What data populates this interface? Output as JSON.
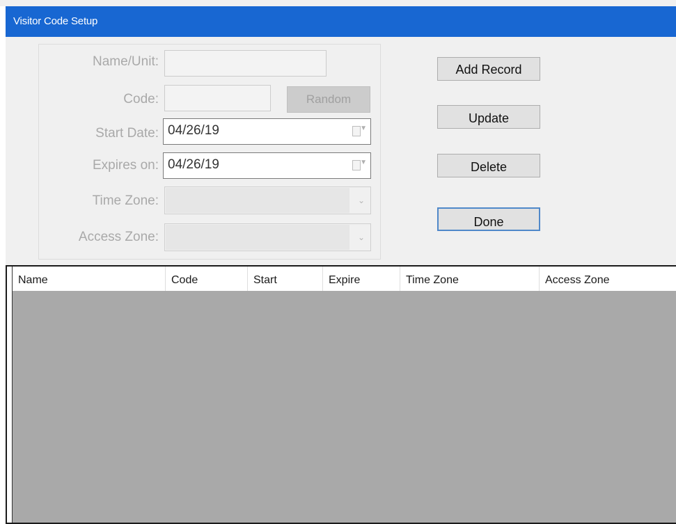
{
  "window": {
    "title": "Visitor Code Setup"
  },
  "form": {
    "name_label": "Name/Unit:",
    "name_value": "",
    "code_label": "Code:",
    "code_value": "",
    "random_label": "Random",
    "start_label": "Start Date:",
    "start_value": "04/26/19",
    "expires_label": "Expires on:",
    "expires_value": "04/26/19",
    "timezone_label": "Time Zone:",
    "timezone_value": "",
    "accesszone_label": "Access Zone:",
    "accesszone_value": ""
  },
  "actions": {
    "add_label": "Add Record",
    "update_label": "Update",
    "delete_label": "Delete",
    "done_label": "Done"
  },
  "list": {
    "columns": [
      "Name",
      "Code",
      "Start",
      "Expire",
      "Time Zone",
      "Access Zone"
    ],
    "rows": []
  }
}
